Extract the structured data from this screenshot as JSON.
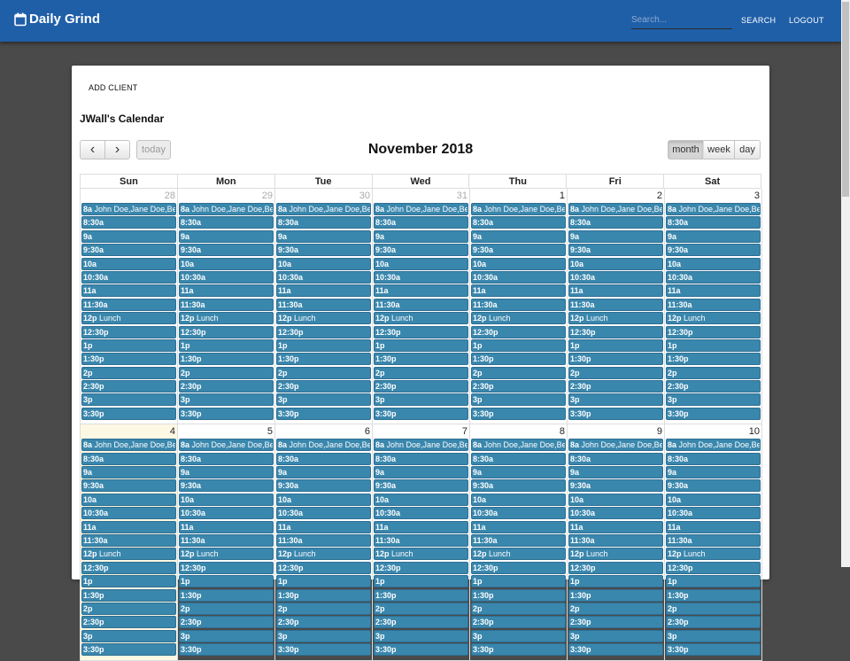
{
  "app": {
    "title": "Daily Grind"
  },
  "nav": {
    "search_placeholder": "Search...",
    "search_label": "SEARCH",
    "logout_label": "LOGOUT"
  },
  "card": {
    "add_client_label": "ADD CLIENT",
    "calendar_title": "JWall's Calendar"
  },
  "toolbar": {
    "prev_icon": "‹",
    "next_icon": "›",
    "today_label": "today",
    "title": "November 2018",
    "views": [
      "month",
      "week",
      "day"
    ],
    "active_view": "month"
  },
  "days_of_week": [
    "Sun",
    "Mon",
    "Tue",
    "Wed",
    "Thu",
    "Fri",
    "Sat"
  ],
  "weeks": [
    [
      {
        "day": "28",
        "other": true
      },
      {
        "day": "29",
        "other": true
      },
      {
        "day": "30",
        "other": true
      },
      {
        "day": "31",
        "other": true
      },
      {
        "day": "1"
      },
      {
        "day": "2"
      },
      {
        "day": "3"
      }
    ],
    [
      {
        "day": "4",
        "today": true
      },
      {
        "day": "5"
      },
      {
        "day": "6"
      },
      {
        "day": "7"
      },
      {
        "day": "8"
      },
      {
        "day": "9"
      },
      {
        "day": "10"
      }
    ]
  ],
  "events": [
    {
      "time": "8a",
      "title": "John Doe,Jane Doe,Ben S"
    },
    {
      "time": "8:30a",
      "title": ""
    },
    {
      "time": "9a",
      "title": ""
    },
    {
      "time": "9:30a",
      "title": ""
    },
    {
      "time": "10a",
      "title": ""
    },
    {
      "time": "10:30a",
      "title": ""
    },
    {
      "time": "11a",
      "title": ""
    },
    {
      "time": "11:30a",
      "title": ""
    },
    {
      "time": "12p",
      "title": "Lunch"
    },
    {
      "time": "12:30p",
      "title": ""
    },
    {
      "time": "1p",
      "title": ""
    },
    {
      "time": "1:30p",
      "title": ""
    },
    {
      "time": "2p",
      "title": ""
    },
    {
      "time": "2:30p",
      "title": ""
    },
    {
      "time": "3p",
      "title": ""
    },
    {
      "time": "3:30p",
      "title": ""
    }
  ],
  "colors": {
    "topbar": "#1f5fa8",
    "event": "#3a87ad",
    "today_bg": "#fcf8e3",
    "backdrop": "#4a4a4a"
  }
}
